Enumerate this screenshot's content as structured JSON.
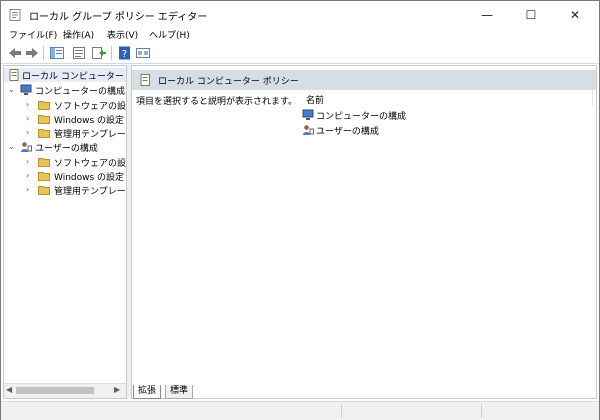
{
  "window": {
    "title": "ローカル グループ ポリシー エディター",
    "controls": {
      "minimize": "—",
      "maximize": "☐",
      "close": "✕"
    }
  },
  "menu": [
    "ファイル(F)",
    "操作(A)",
    "表示(V)",
    "ヘルプ(H)"
  ],
  "toolbar": {
    "icons": [
      "back-arrow-icon",
      "forward-arrow-icon",
      "show-hide-tree-icon",
      "properties-icon",
      "export-list-icon",
      "help-icon",
      "filter-icon"
    ]
  },
  "tree": {
    "root": "ローカル コンピューター ポリシー",
    "computer_config": "コンピューターの構成",
    "computer_children": [
      "ソフトウェアの設定",
      "Windows の設定",
      "管理用テンプレート"
    ],
    "user_config": "ユーザーの構成",
    "user_children": [
      "ソフトウェアの設定",
      "Windows の設定",
      "管理用テンプレート"
    ]
  },
  "content": {
    "header_title": "ローカル コンピューター ポリシー",
    "description": "項目を選択すると説明が表示されます。",
    "column_name": "名前",
    "items": [
      "コンピューターの構成",
      "ユーザーの構成"
    ]
  },
  "tabs": [
    "拡張",
    "標準"
  ],
  "colors": {
    "folder": "#e8c25a",
    "header_bg": "#d7dde6",
    "selection": "#e5eef8"
  }
}
